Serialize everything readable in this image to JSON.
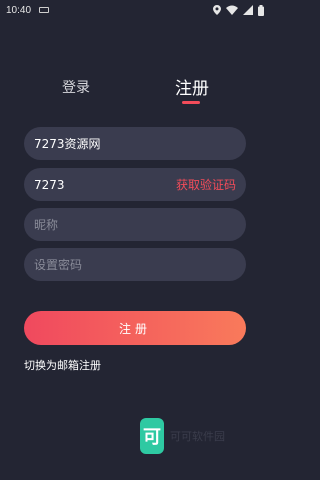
{
  "status_bar": {
    "time": "10:40",
    "icons": [
      "notification-icon",
      "location-icon",
      "wifi-icon",
      "signal-icon",
      "battery-icon"
    ]
  },
  "tabs": [
    {
      "label": "登录",
      "active": false
    },
    {
      "label": "注册",
      "active": true
    }
  ],
  "form": {
    "username": {
      "value": "7273资源网"
    },
    "phone": {
      "value": "7273",
      "code_button": "获取验证码"
    },
    "nickname": {
      "placeholder": "昵称"
    },
    "password": {
      "placeholder": "设置密码"
    }
  },
  "submit_label": "注册",
  "switch_link": "切换为邮箱注册",
  "watermark": {
    "glyph": "可",
    "text": "可可软件园"
  },
  "colors": {
    "background": "#232533",
    "field": "#3a3c4f",
    "accent": "#f24c5a",
    "gradient_end": "#f97a5b",
    "logo": "#2ec9a2"
  }
}
